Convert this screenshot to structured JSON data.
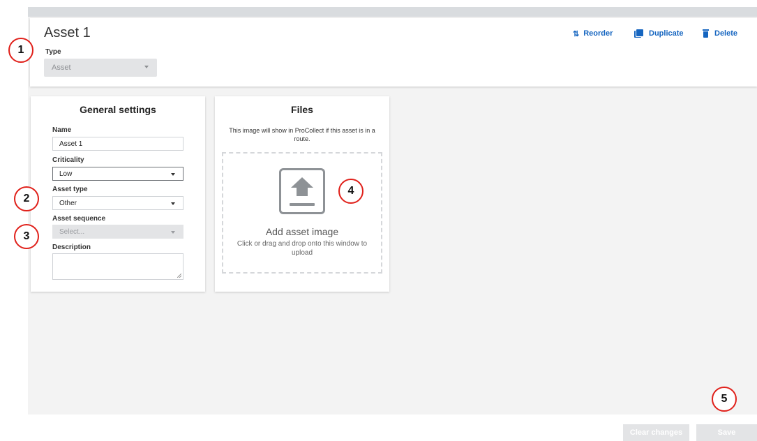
{
  "header": {
    "asset_title": "Asset 1",
    "type_label": "Type",
    "type_value": "Asset",
    "actions": {
      "reorder": "Reorder",
      "duplicate": "Duplicate",
      "delete": "Delete"
    },
    "reorder_icon_glyph": "⇅"
  },
  "general_settings": {
    "title": "General settings",
    "name_label": "Name",
    "name_value": "Asset 1",
    "criticality_label": "Criticality",
    "criticality_value": "Low",
    "asset_type_label": "Asset type",
    "asset_type_value": "Other",
    "asset_sequence_label": "Asset sequence",
    "asset_sequence_placeholder": "Select...",
    "description_label": "Description"
  },
  "files": {
    "title": "Files",
    "description": "This image will show in ProCollect if this asset is in a route.",
    "upload_title": "Add asset image",
    "upload_subtitle": "Click or drag and drop onto this window to upload"
  },
  "footer": {
    "clear_changes": "Clear changes",
    "save": "Save"
  },
  "callouts": [
    "1",
    "2",
    "3",
    "4",
    "5"
  ],
  "colors": {
    "accent": "#1565c0",
    "callout_ring": "#e0201a",
    "workspace_bg": "#f3f3f3",
    "disabled": "#e3e4e6"
  },
  "icons": [
    "reorder-icon",
    "duplicate-icon",
    "delete-icon",
    "upload-icon",
    "chevron-down-icon"
  ]
}
